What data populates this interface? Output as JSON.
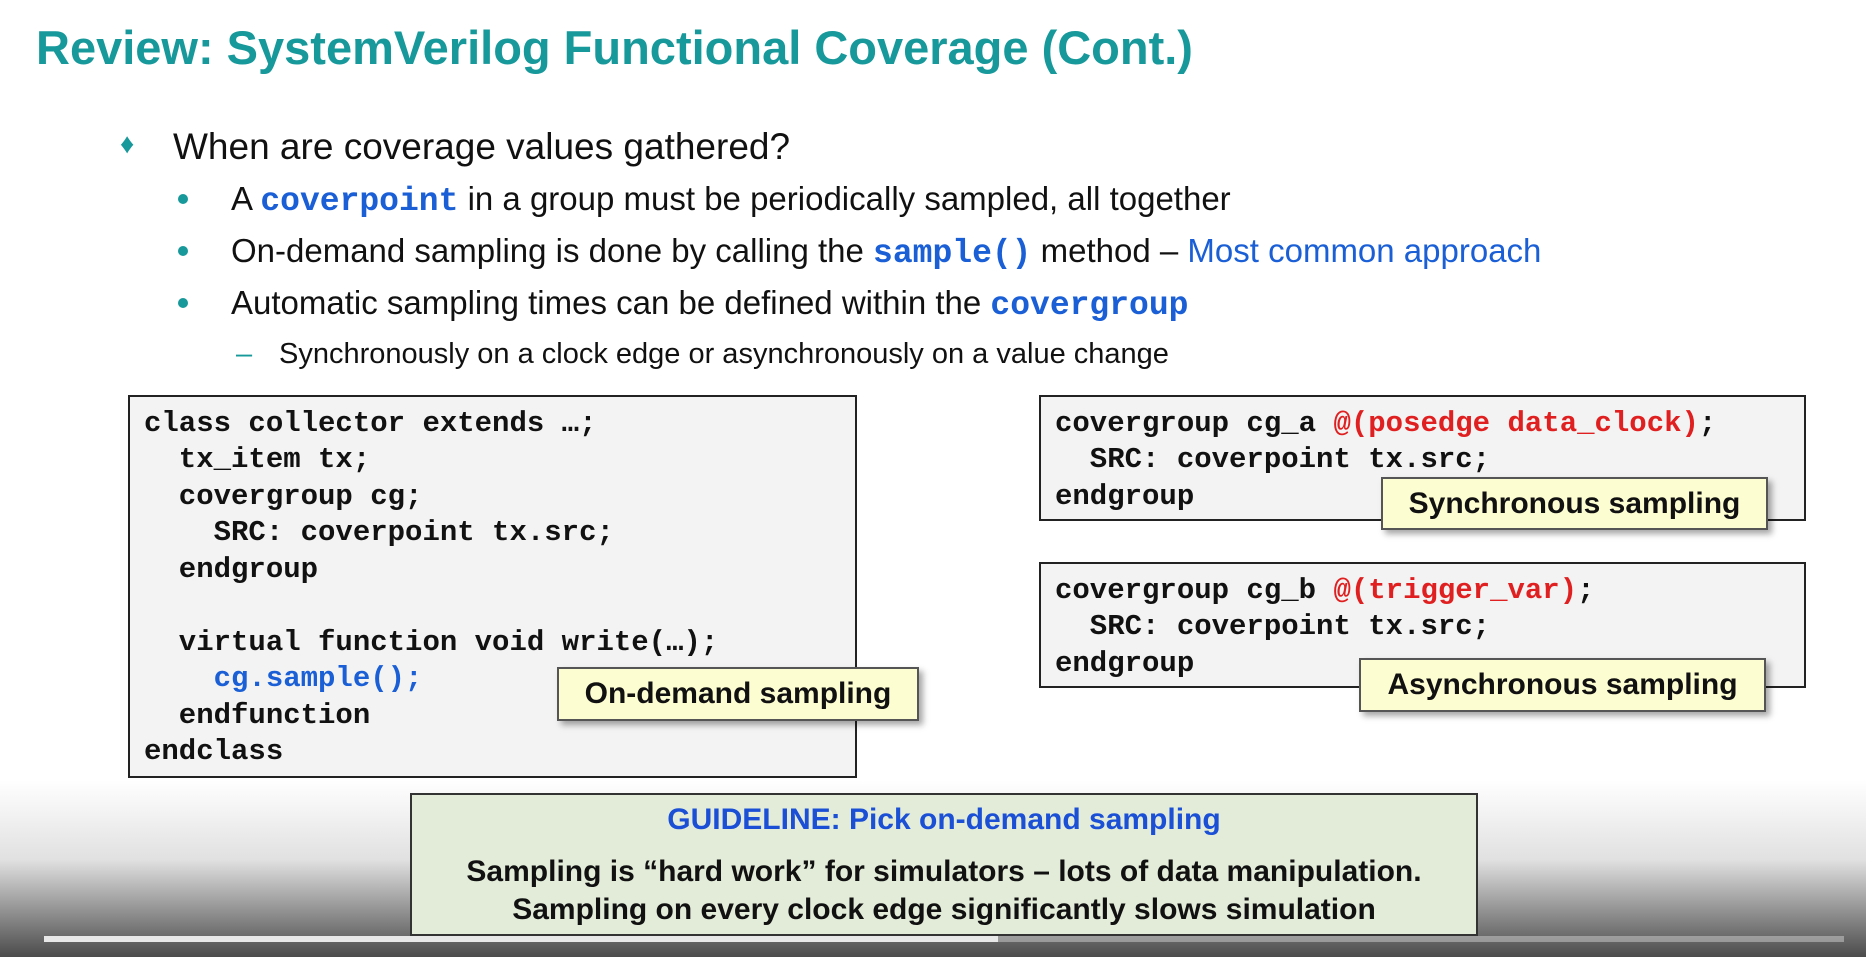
{
  "title": "Review: SystemVerilog Functional Coverage (Cont.)",
  "bullet_main": "When are coverage values gathered?",
  "sub1": {
    "pre": "A ",
    "kw": "coverpoint",
    "post": " in a group must be periodically sampled, all together"
  },
  "sub2": {
    "pre": "On-demand sampling is done by calling the ",
    "kw": "sample()",
    "mid": " method – ",
    "link": "Most common approach"
  },
  "sub3": {
    "pre": "Automatic sampling times can be defined within the ",
    "kw": "covergroup"
  },
  "sub3_dash": {
    "marker": "–",
    "text": "Synchronously on a clock edge or asynchronously on a value change"
  },
  "left_code": [
    "class collector extends …;",
    "  tx_item tx;",
    "  covergroup cg;",
    "    SRC: coverpoint tx.src;",
    "  endgroup",
    "",
    "  virtual function void write(…);",
    "    cg.sample();",
    "  endfunction",
    "endclass"
  ],
  "rtop_code": {
    "line1_pre": "covergroup cg_a ",
    "line1_event": "@(posedge data_clock)",
    "line1_post": ";",
    "line2": "  SRC: coverpoint tx.src;",
    "line3": "endgroup"
  },
  "rbot_code": {
    "line1_pre": "covergroup cg_b ",
    "line1_event": "@(trigger_var)",
    "line1_post": ";",
    "line2": "  SRC: coverpoint tx.src;",
    "line3": "endgroup"
  },
  "callouts": {
    "on_demand": "On-demand sampling",
    "sync": "Synchronous sampling",
    "async": "Asynchronous sampling"
  },
  "guideline": {
    "head": "GUIDELINE:  Pick on-demand sampling",
    "line1": "Sampling is “hard work” for simulators – lots of data manipulation.",
    "line2": "Sampling on every clock edge significantly slows simulation"
  },
  "icons": {
    "bullet1": "diamond-bullet-icon",
    "bullet2": "dot-bullet-icon"
  },
  "colors": {
    "title": "#17989a",
    "keyword": "#1a5fd6",
    "event": "#e02020",
    "callout_bg": "#fdfdd2",
    "guideline_bg": "#e2ecd9"
  },
  "video_progress": 0.53
}
